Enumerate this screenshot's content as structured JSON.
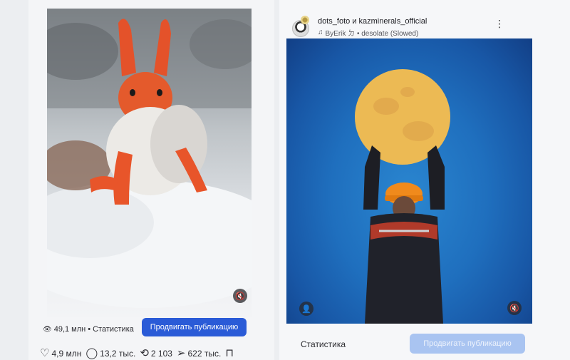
{
  "left_post": {
    "views": "49,1 млн",
    "stats_link": "Статистика",
    "separator": "•",
    "promote_label": "Продвигать публикацию",
    "metrics": {
      "likes": "4,9 млн",
      "comments": "13,2 тыс.",
      "reposts": "2 103",
      "shares": "622 тыс."
    }
  },
  "right_post": {
    "author": "dots_foto и kazminerals_official",
    "audio": "ByErik ㄉ • desolate (Slowed)",
    "stats_link": "Статистика",
    "promote_label": "Продвигать публикацию"
  },
  "colors": {
    "promote_active": "#2a5bd7",
    "promote_disabled": "#a9c4f1",
    "moon_background": "#1f6fbe"
  },
  "icons": {
    "views": "eye-icon",
    "likes": "heart-icon",
    "comments": "comment-icon",
    "reposts": "repost-icon",
    "shares": "send-icon",
    "save": "bookmark-icon",
    "audio": "music-note-icon",
    "mute": "speaker-muted-icon",
    "tagged": "user-icon",
    "menu": "more-vertical-icon"
  }
}
